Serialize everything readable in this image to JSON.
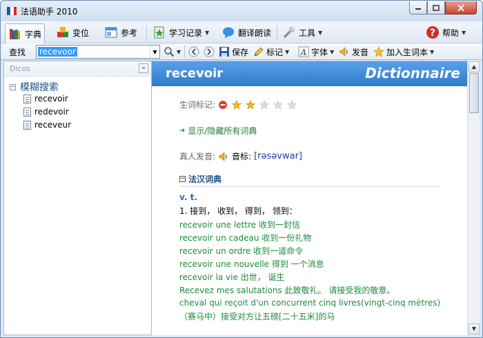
{
  "window": {
    "title": "法语助手 2010"
  },
  "toolbar": {
    "dictionary": "字典",
    "conjugation": "变位",
    "reference": "参考",
    "study_records": "学习记录",
    "translate_read": "翻译朗读",
    "tools": "工具",
    "help": "帮助"
  },
  "toolbar2": {
    "lookup_label": "查找",
    "search_value": "recevoor",
    "save": "保存",
    "mark": "标记",
    "font": "字体",
    "pronounce": "发音",
    "add_vocab": "加入生词本"
  },
  "sidebar": {
    "header": "Dicos",
    "root_label": "模糊搜索",
    "items": [
      {
        "label": "recevoir"
      },
      {
        "label": "redevoir"
      },
      {
        "label": "receveur"
      }
    ]
  },
  "entry": {
    "headword": "recevoir",
    "brand": "Dictionnaire",
    "vocab_mark_label": "生词标记:",
    "stars_filled": 2,
    "stars_total": 5,
    "toggle_link": "显示/隐藏所有词典",
    "pronunciation_label": "真人发音:",
    "phonetic_label": "音标:",
    "phonetic": "[rəsəvwar]",
    "section_title": "法汉词典",
    "pos": "v. t.",
    "sense1": "1. 接到， 收到， 得到， 领到：",
    "examples": [
      "recevoir une lettre 收到一封信",
      "recevoir un cadeau 收到一份礼物",
      "recevoir un ordre 收到一道命令",
      "recevoir une nouvelle 得到 一个消息",
      "recevoir la vie 出世， 诞生",
      "Recevez mes salutations 此致敬礼。 请接受我的敬意。",
      "cheval qui reçoit d'un concurrent cinq livres(vingt-cinq mètres)",
      "（赛马中）接受对方让五磅[二十五米]的马"
    ]
  },
  "colors": {
    "header_blue": "#3b86d8",
    "link_green": "#1d7b2f",
    "title_blue": "#1f4f8a"
  }
}
